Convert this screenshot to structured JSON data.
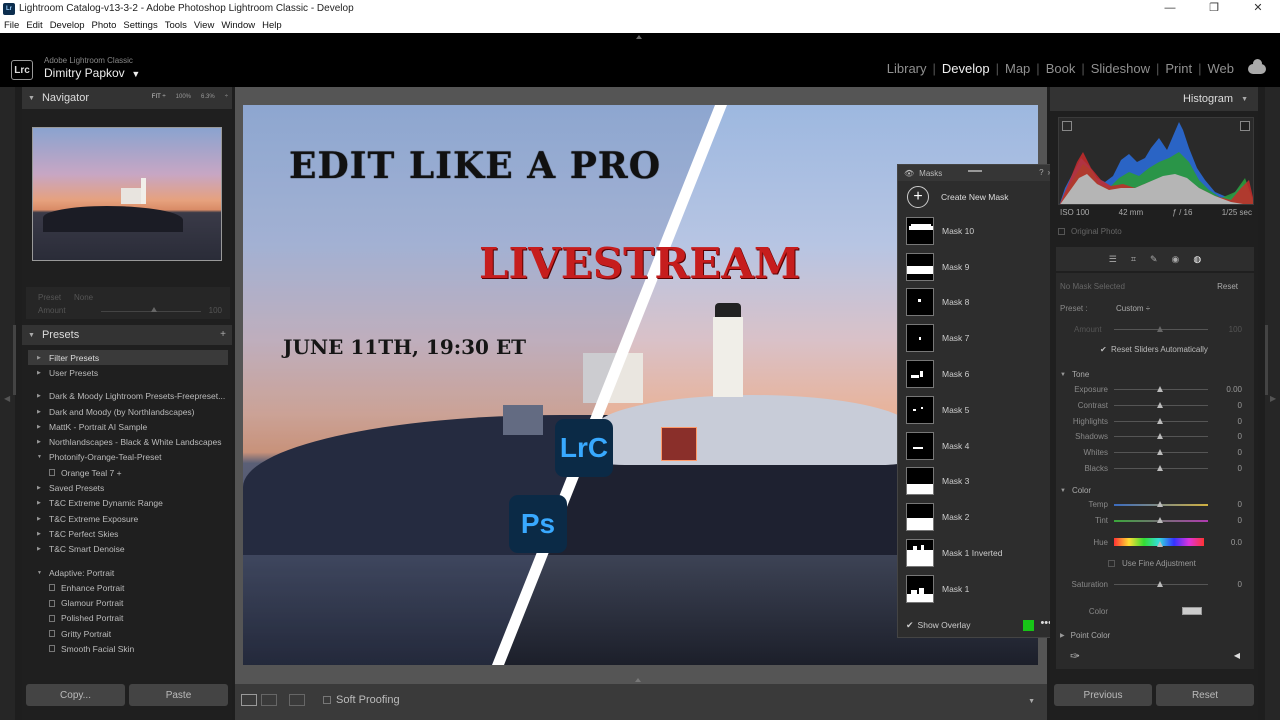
{
  "window": {
    "title": "Lightroom Catalog-v13-3-2 - Adobe Photoshop Lightroom Classic - Develop",
    "min": "—",
    "max": "❐",
    "close": "✕"
  },
  "menu": [
    "File",
    "Edit",
    "Develop",
    "Photo",
    "Settings",
    "Tools",
    "View",
    "Window",
    "Help"
  ],
  "identity": {
    "logo": "Lrc",
    "brand": "Adobe Lightroom Classic",
    "user": "Dimitry Papkov",
    "user_arrow": "▼"
  },
  "modules": [
    "Library",
    "Develop",
    "Map",
    "Book",
    "Slideshow",
    "Print",
    "Web"
  ],
  "active_module": "Develop",
  "navigator": {
    "title": "Navigator",
    "fit": "FIT ÷",
    "z1": "100%",
    "z2": "6.3%",
    "z3": "÷"
  },
  "preset_amount": {
    "preset_label": "Preset",
    "preset_value": "None",
    "amount_label": "Amount",
    "amount_value": "100"
  },
  "presets": {
    "title": "Presets",
    "add": "+",
    "items": [
      {
        "label": "Filter Presets",
        "type": "sel"
      },
      {
        "label": "User Presets",
        "type": "group"
      },
      {
        "label": "",
        "type": "gap"
      },
      {
        "label": "Dark & Moody Lightroom Presets-Freepreset...",
        "type": "group"
      },
      {
        "label": "Dark and Moody (by Northlandscapes)",
        "type": "group"
      },
      {
        "label": "MattK - Portrait AI Sample",
        "type": "group"
      },
      {
        "label": "Northlandscapes - Black & White Landscapes",
        "type": "group"
      },
      {
        "label": "Photonify-Orange-Teal-Preset",
        "type": "open"
      },
      {
        "label": "Orange Teal 7 +",
        "type": "child"
      },
      {
        "label": "Saved Presets",
        "type": "group"
      },
      {
        "label": "T&C Extreme Dynamic Range",
        "type": "group"
      },
      {
        "label": "T&C Extreme Exposure",
        "type": "group"
      },
      {
        "label": "T&C Perfect Skies",
        "type": "group"
      },
      {
        "label": "T&C Smart Denoise",
        "type": "group"
      },
      {
        "label": "",
        "type": "gap"
      },
      {
        "label": "Adaptive: Portrait",
        "type": "open"
      },
      {
        "label": "Enhance Portrait",
        "type": "child"
      },
      {
        "label": "Glamour Portrait",
        "type": "child"
      },
      {
        "label": "Polished Portrait",
        "type": "child"
      },
      {
        "label": "Gritty Portrait",
        "type": "child"
      },
      {
        "label": "Smooth Facial Skin",
        "type": "child"
      }
    ],
    "copy": "Copy...",
    "paste": "Paste"
  },
  "thumbnail": {
    "title1": "EDIT LIKE A PRO",
    "title2": "LIVESTREAM",
    "title3": "JUNE 11TH, 19:30 ET",
    "badge_lrc": "LrC",
    "badge_ps": "Ps"
  },
  "toolbar": {
    "soft_proofing": "Soft Proofing",
    "dropdown": "▼"
  },
  "masks": {
    "title": "Masks",
    "help": "?",
    "close": "»",
    "create": "Create New Mask",
    "list": [
      "Mask 10",
      "Mask 9",
      "Mask 8",
      "Mask 7",
      "Mask 6",
      "Mask 5",
      "Mask 4",
      "Mask 3",
      "Mask 2",
      "Mask 1 Inverted",
      "Mask 1"
    ],
    "show_overlay": "Show Overlay",
    "overlay_color": "#17c417",
    "more": "•••"
  },
  "histogram": {
    "title": "Histogram",
    "iso": "ISO 100",
    "focal": "42 mm",
    "aperture": "ƒ / 16",
    "shutter": "1/25 sec",
    "original": "Original Photo"
  },
  "mask_panel": {
    "no_mask": "No Mask Selected",
    "reset": "Reset",
    "preset_label": "Preset :",
    "preset_value": "Custom ÷",
    "amount_label": "Amount",
    "amount_value": "100",
    "reset_sliders": "Reset Sliders Automatically",
    "tone": "Tone",
    "tone_sliders": [
      {
        "label": "Exposure",
        "value": "0.00"
      },
      {
        "label": "Contrast",
        "value": "0"
      },
      {
        "label": "Highlights",
        "value": "0"
      },
      {
        "label": "Shadows",
        "value": "0"
      },
      {
        "label": "Whites",
        "value": "0"
      },
      {
        "label": "Blacks",
        "value": "0"
      }
    ],
    "color": "Color",
    "temp": "Temp",
    "temp_value": "0",
    "tint": "Tint",
    "tint_value": "0",
    "hue": "Hue",
    "hue_value": "0.0",
    "fine": "Use Fine Adjustment",
    "saturation": "Saturation",
    "saturation_value": "0",
    "color_label": "Color",
    "point_color": "Point Color"
  },
  "bottom": {
    "previous": "Previous",
    "reset": "Reset"
  }
}
